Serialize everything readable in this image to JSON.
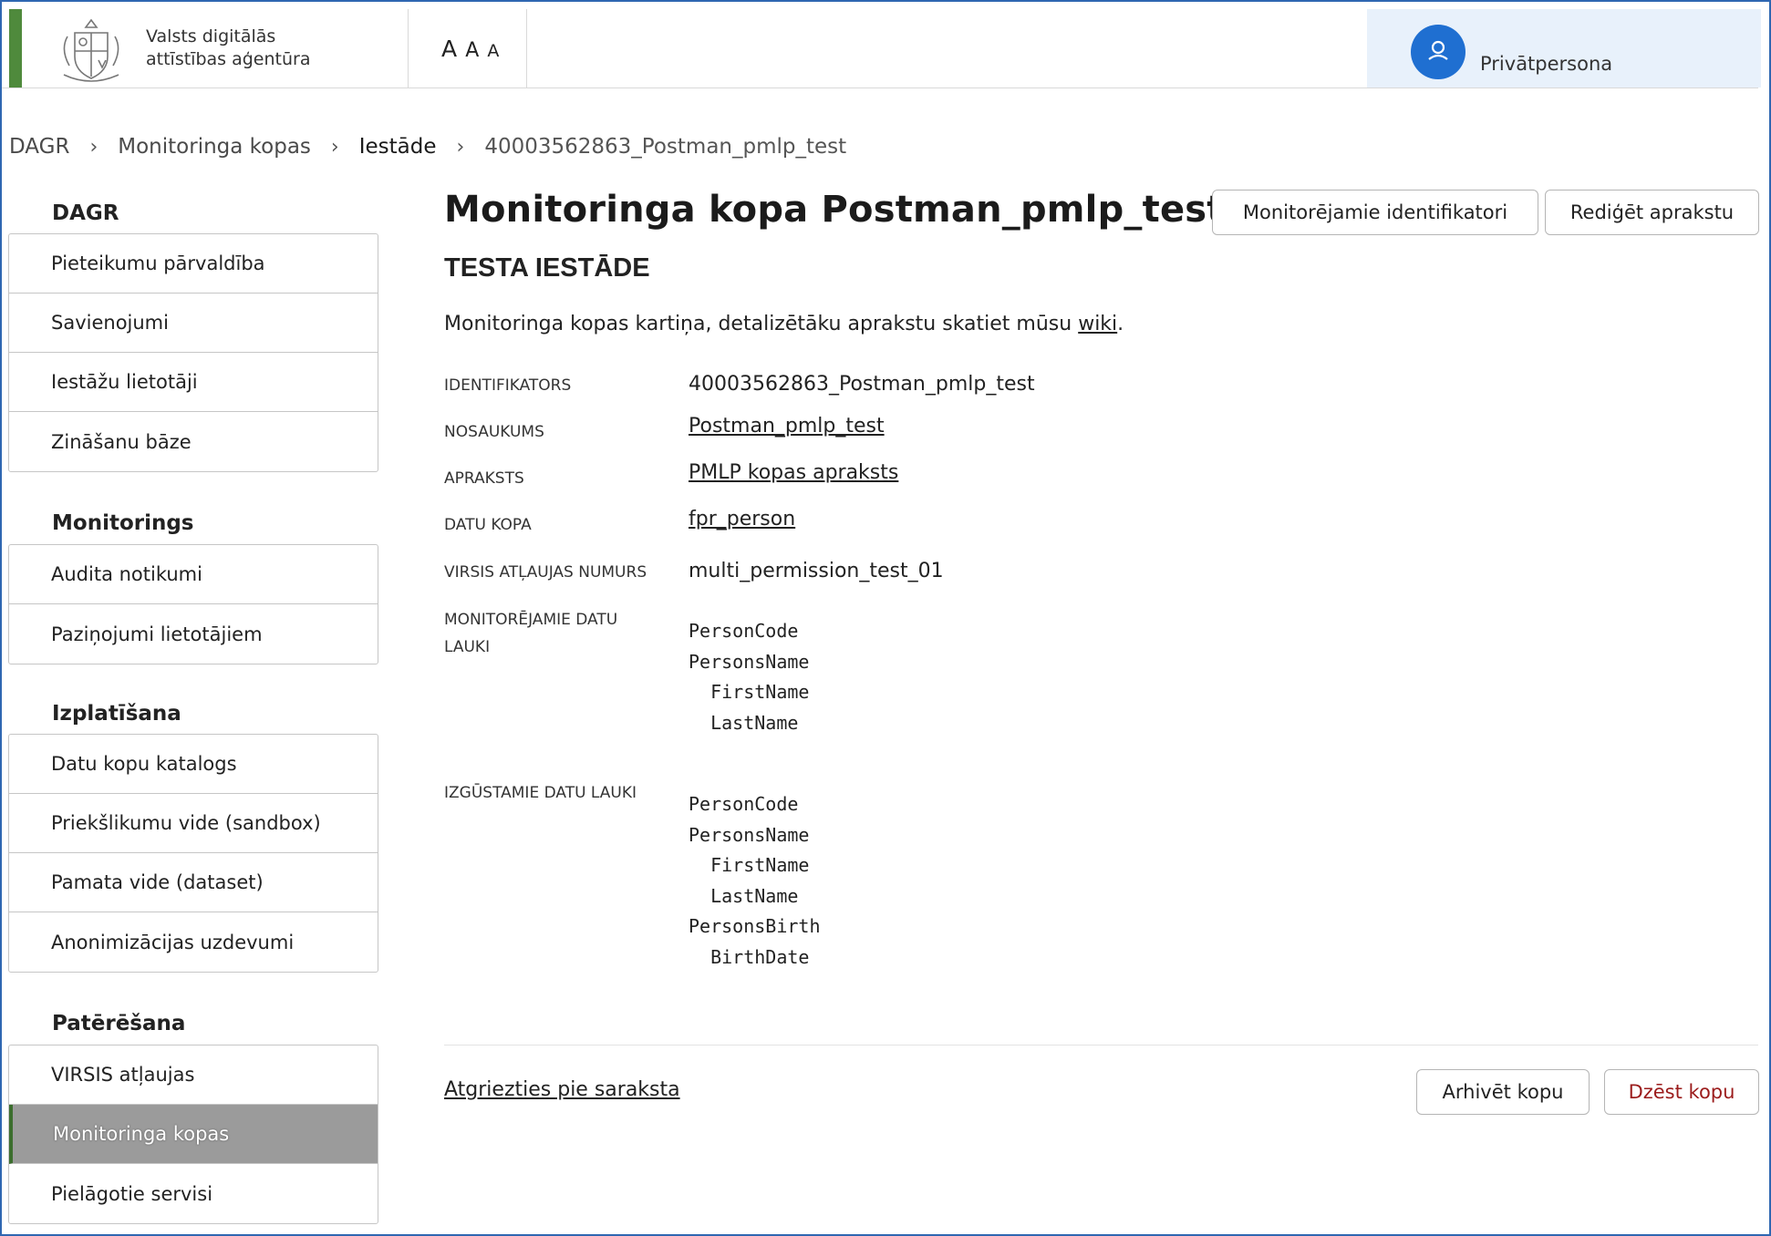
{
  "header": {
    "agency_line1": "Valsts digitālās",
    "agency_line2": "attīstības aģentūra",
    "font_sizes": [
      "A",
      "A",
      "A"
    ],
    "user_name": "Privātpersona",
    "user_icon": "user-icon"
  },
  "breadcrumb": {
    "items": [
      "DAGR",
      "Monitoringa kopas",
      "Iestāde",
      "40003562863_Postman_pmlp_test"
    ]
  },
  "sidebar": {
    "sections": [
      {
        "title": "DAGR",
        "items": [
          "Pieteikumu pārvaldība",
          "Savienojumi",
          "Iestāžu lietotāji",
          "Zināšanu bāze"
        ]
      },
      {
        "title": "Monitorings",
        "items": [
          "Audita notikumi",
          "Paziņojumi lietotājiem"
        ]
      },
      {
        "title": "Izplatīšana",
        "items": [
          "Datu kopu katalogs",
          "Priekšlikumu vide (sandbox)",
          "Pamata vide (dataset)",
          "Anonimizācijas uzdevumi"
        ]
      },
      {
        "title": "Patērēšana",
        "items": [
          "VIRSIS atļaujas",
          "Monitoringa kopas",
          "Pielāgotie servisi"
        ]
      }
    ],
    "active_item": "Monitoringa kopas"
  },
  "main": {
    "title": "Monitoringa kopa Postman_pmlp_test",
    "subtitle": "TESTA IESTĀDE",
    "intro_text": "Monitoringa kopas kartiņa, detalizētāku aprakstu skatiet mūsu",
    "intro_link": "wiki",
    "intro_end": ".",
    "buttons": {
      "identifiers": "Monitorējamie identifikatori",
      "edit": "Rediģēt aprakstu",
      "archive": "Arhivēt kopu",
      "delete": "Dzēst kopu"
    },
    "fields": {
      "identifier": {
        "label": "IDENTIFIKATORS",
        "value": "40003562863_Postman_pmlp_test"
      },
      "name": {
        "label": "NOSAUKUMS",
        "value": "Postman_pmlp_test"
      },
      "description": {
        "label": "APRAKSTS",
        "value": "PMLP kopas apraksts"
      },
      "dataset": {
        "label": "DATU KOPA",
        "value": "fpr_person"
      },
      "permission": {
        "label": "VIRSIS ATĻAUJAS NUMURS",
        "value": "multi_permission_test_01"
      },
      "monitored_fields": {
        "label_line1": "MONITORĒJAMIE DATU",
        "label_line2": "LAUKI",
        "value": "PersonCode\nPersonsName\n  FirstName\n  LastName"
      },
      "retrieved_fields": {
        "label": "IZGŪSTAMIE DATU LAUKI",
        "value": "PersonCode\nPersonsName\n  FirstName\n  LastName\nPersonsBirth\n  BirthDate"
      }
    },
    "back_link": "Atgriezties pie saraksta"
  }
}
